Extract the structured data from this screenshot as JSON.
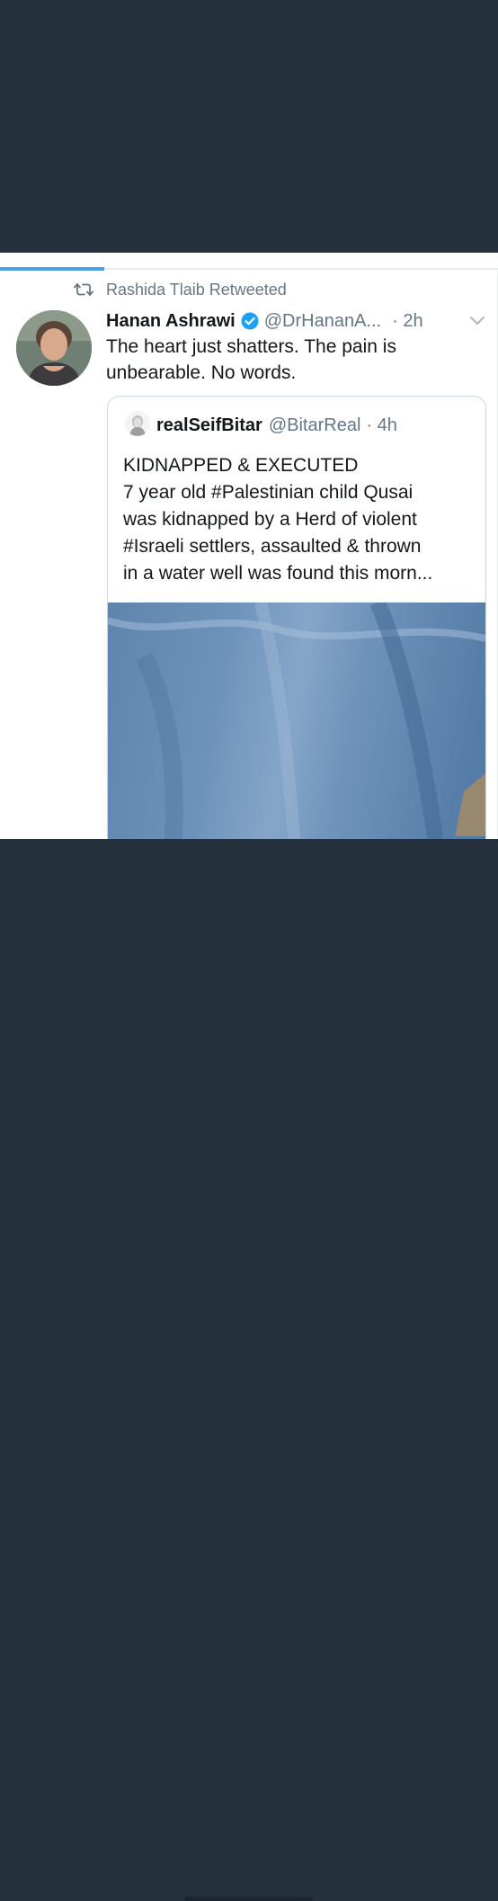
{
  "retweet_context": {
    "label": "Rashida Tlaib Retweeted",
    "icon": "retweet-icon"
  },
  "progress": {
    "fraction": 0.21,
    "color": "#4aa1eb"
  },
  "tweet": {
    "author_name": "Hanan Ashrawi",
    "verified": true,
    "handle": "@DrHananA...",
    "separator_time": "· 2h",
    "text": "The heart just shatters. The pain is unbearable. No words.",
    "avatar_icon": "avatar",
    "menu_icon": "chevron-down-icon"
  },
  "quoted_tweet": {
    "author_name": "realSeifBitar",
    "handle": "@BitarReal",
    "separator_time": "· 4h",
    "text_lines": [
      "KIDNAPPED & EXECUTED",
      "7 year old #Palestinian child Qusai",
      "was kidnapped by a Herd of violent",
      "#Israeli settlers, assaulted & thrown",
      "in a water well was found this morn..."
    ],
    "media_icon": "video-thumbnail"
  },
  "colors": {
    "background_dark": "#25303d",
    "card": "#ffffff",
    "accent_blue": "#1da1f2",
    "text_primary": "#14171a",
    "text_secondary": "#657786"
  }
}
